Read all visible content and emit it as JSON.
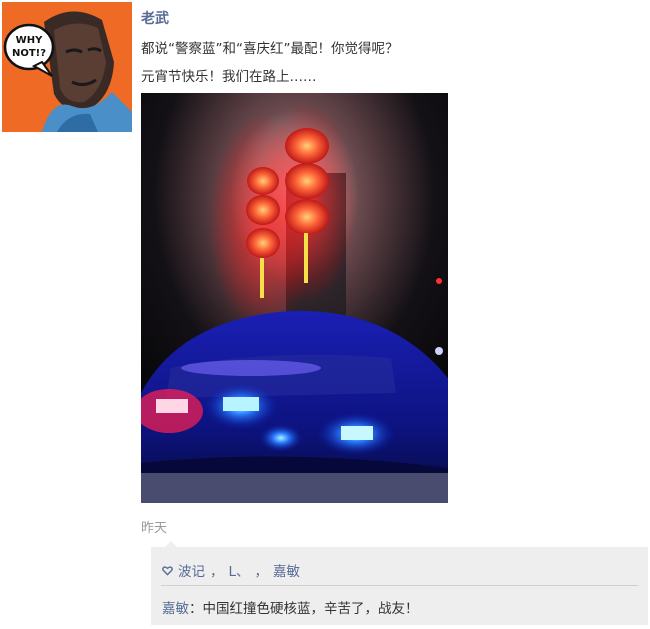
{
  "post": {
    "author": "老武",
    "line1": "都说“警察蓝”和“喜庆红”最配！你觉得呢？",
    "line2": "元宵节快乐！我们在路上……",
    "time": "昨天",
    "avatar_text": "WHY NOT!?",
    "avatar_icon": "cartoon-portrait"
  },
  "likes": {
    "icon": "heart-outline-icon",
    "names": [
      "波记",
      "L、",
      "嘉敏"
    ],
    "separator": "，"
  },
  "comments": [
    {
      "author": "嘉敏",
      "separator": "：",
      "text": "中国红撞色硬核蓝，辛苦了，战友！"
    }
  ],
  "colors": {
    "name_blue": "#576b95",
    "avatar_bg": "#ef6a24",
    "comment_bg": "#eeeeee"
  }
}
